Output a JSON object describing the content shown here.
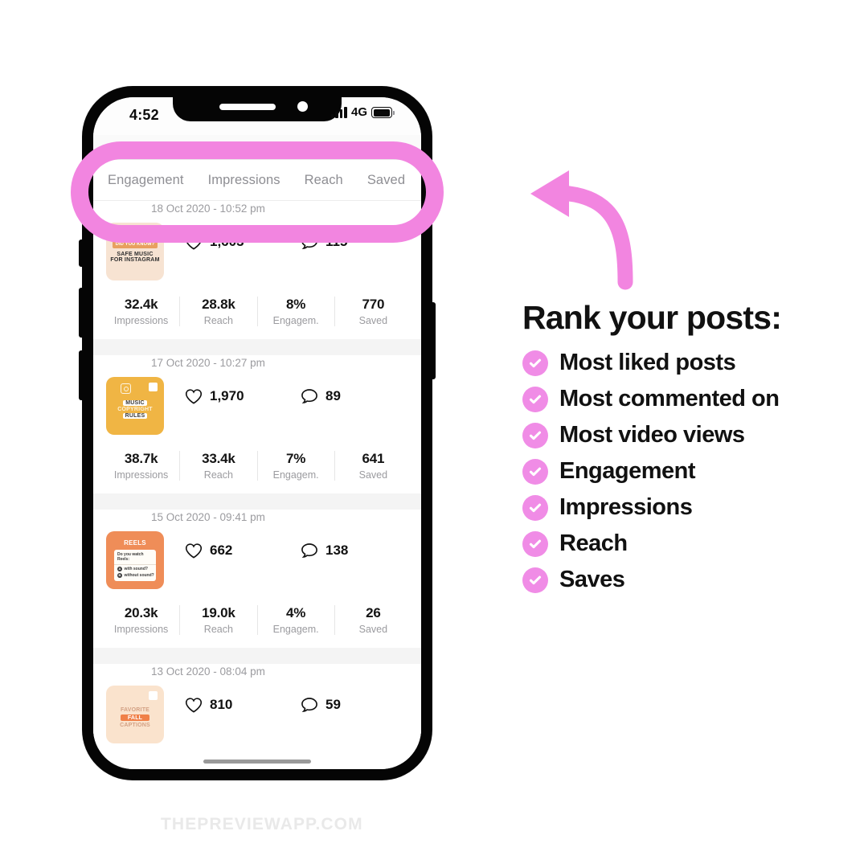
{
  "phone": {
    "status_bar": {
      "time": "4:52",
      "network": "4G",
      "signal_icon": "signal-bars-icon",
      "battery_icon": "battery-full-icon"
    },
    "tabs": [
      {
        "label": "Engagement"
      },
      {
        "label": "Impressions"
      },
      {
        "label": "Reach"
      },
      {
        "label": "Saved"
      }
    ],
    "posts": [
      {
        "date": "18 Oct 2020 - 10:52 pm",
        "likes": "1,603",
        "comments": "115",
        "thumb": {
          "bg": "#f7e3d2",
          "badge": "DID YOU KNOW?",
          "line1": "SAFE MUSIC",
          "line2": "FOR INSTAGRAM",
          "text_color": "#2f2f2f"
        },
        "stats": [
          {
            "value": "32.4k",
            "label": "Impressions"
          },
          {
            "value": "28.8k",
            "label": "Reach"
          },
          {
            "value": "8%",
            "label": "Engagem."
          },
          {
            "value": "770",
            "label": "Saved"
          }
        ]
      },
      {
        "date": "17 Oct 2020 - 10:27 pm",
        "likes": "1,970",
        "comments": "89",
        "thumb": {
          "bg": "#f0b544",
          "line1": "MUSIC",
          "line2": "COPYRIGHT",
          "line3": "RULES",
          "text_color": "#3a3a3a",
          "has_instagram_icon": true,
          "has_carousel_icon": true
        },
        "stats": [
          {
            "value": "38.7k",
            "label": "Impressions"
          },
          {
            "value": "33.4k",
            "label": "Reach"
          },
          {
            "value": "7%",
            "label": "Engagem."
          },
          {
            "value": "641",
            "label": "Saved"
          }
        ]
      },
      {
        "date": "15 Oct 2020 - 09:41 pm",
        "likes": "662",
        "comments": "138",
        "thumb": {
          "bg": "#ef8d58",
          "title": "REELS",
          "poll_question": "Do you watch Reels:",
          "poll_options": [
            {
              "key": "A",
              "text": "with sound?"
            },
            {
              "key": "B",
              "text": "without sound?"
            }
          ]
        },
        "stats": [
          {
            "value": "20.3k",
            "label": "Impressions"
          },
          {
            "value": "19.0k",
            "label": "Reach"
          },
          {
            "value": "4%",
            "label": "Engagem."
          },
          {
            "value": "26",
            "label": "Saved"
          }
        ]
      },
      {
        "date": "13 Oct 2020 - 08:04 pm",
        "likes": "810",
        "comments": "59",
        "thumb": {
          "bg": "#fae3cd",
          "line1": "FAVORITE",
          "line2": "FALL",
          "line3": "CAPTIONS",
          "text_color": "#d3a184",
          "pill_bg": "#f08048",
          "has_carousel_icon": true
        },
        "stats": []
      }
    ]
  },
  "annotation": {
    "highlight_color": "#f285e0",
    "arrow_color": "#f285e0",
    "arrow_icon": "curved-arrow-left-icon"
  },
  "right_panel": {
    "title": "Rank your posts:",
    "check_color": "#f08ce6",
    "items": [
      {
        "label": "Most liked posts"
      },
      {
        "label": "Most commented on"
      },
      {
        "label": "Most video views"
      },
      {
        "label": "Engagement"
      },
      {
        "label": "Impressions"
      },
      {
        "label": "Reach"
      },
      {
        "label": "Saves"
      }
    ]
  },
  "watermark": {
    "text": "THEPREVIEWAPP.COM"
  }
}
